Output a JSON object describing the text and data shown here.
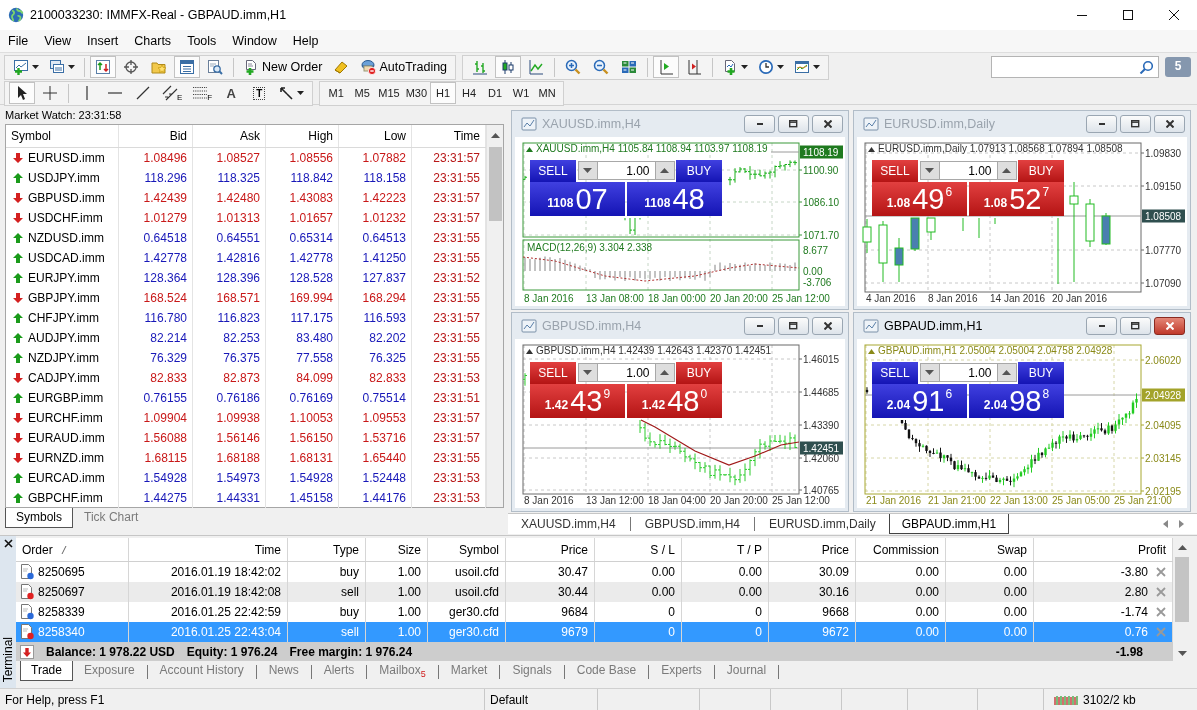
{
  "window": {
    "title": "2100033230: IMMFX-Real - GBPAUD.imm,H1"
  },
  "menu": [
    "File",
    "View",
    "Insert",
    "Charts",
    "Tools",
    "Window",
    "Help"
  ],
  "toolbar_top": [
    {
      "sections": [
        [
          {
            "kind": "new-chart",
            "pressed": false,
            "dropdown": true
          },
          {
            "kind": "profiles",
            "pressed": false,
            "dropdown": true
          }
        ],
        [
          {
            "kind": "market-watch",
            "pressed": true
          },
          {
            "kind": "data-window",
            "pressed": false
          },
          {
            "kind": "navigator",
            "pressed": false
          },
          {
            "kind": "terminal",
            "pressed": true
          },
          {
            "kind": "tester",
            "pressed": false
          }
        ],
        [
          {
            "kind": "new-order",
            "pressed": false,
            "label": "New Order"
          },
          {
            "kind": "editor",
            "pressed": false
          },
          {
            "kind": "autotrading",
            "pressed": false,
            "label": "AutoTrading"
          }
        ]
      ]
    },
    {
      "sections": [
        [
          {
            "kind": "bar-chart",
            "pressed": false
          },
          {
            "kind": "candles",
            "pressed": true
          },
          {
            "kind": "line-chart",
            "pressed": false
          }
        ],
        [
          {
            "kind": "zoom-in",
            "pressed": false
          },
          {
            "kind": "zoom-out",
            "pressed": false
          },
          {
            "kind": "tile",
            "pressed": false
          }
        ],
        [
          {
            "kind": "autoscroll",
            "pressed": true
          },
          {
            "kind": "chart-shift",
            "pressed": false
          }
        ],
        [
          {
            "kind": "indicators",
            "pressed": false,
            "dropdown": true
          },
          {
            "kind": "periods",
            "pressed": false,
            "dropdown": true
          },
          {
            "kind": "templates",
            "pressed": false,
            "dropdown": true
          }
        ]
      ]
    }
  ],
  "messages": {
    "count": "5"
  },
  "toolbar_bottom": [
    {
      "sections": [
        [
          {
            "kind": "cursor",
            "pressed": true
          },
          {
            "kind": "crosshair",
            "pressed": false
          }
        ],
        [
          {
            "kind": "vertical-line",
            "pressed": false
          },
          {
            "kind": "horizontal-line",
            "pressed": false
          },
          {
            "kind": "trend-line",
            "pressed": false
          },
          {
            "kind": "channel",
            "pressed": false,
            "mark": "E"
          },
          {
            "kind": "fibonacci",
            "pressed": false,
            "mark": "F"
          },
          {
            "kind": "text",
            "pressed": false,
            "label": "A"
          },
          {
            "kind": "text-label",
            "pressed": false,
            "label": "T"
          },
          {
            "kind": "arrows",
            "pressed": false,
            "dropdown": true
          }
        ]
      ]
    },
    {
      "sections": [
        [
          {
            "kind": "period",
            "label": "M1",
            "pressed": false
          },
          {
            "kind": "period",
            "label": "M5",
            "pressed": false
          },
          {
            "kind": "period",
            "label": "M15",
            "pressed": false
          },
          {
            "kind": "period",
            "label": "M30",
            "pressed": false
          },
          {
            "kind": "period",
            "label": "H1",
            "pressed": true
          },
          {
            "kind": "period",
            "label": "H4",
            "pressed": false
          },
          {
            "kind": "period",
            "label": "D1",
            "pressed": false
          },
          {
            "kind": "period",
            "label": "W1",
            "pressed": false
          },
          {
            "kind": "period",
            "label": "MN",
            "pressed": false
          }
        ]
      ]
    }
  ],
  "market_watch": {
    "title": "Market Watch: 23:31:58",
    "columns": [
      "Symbol",
      "Bid",
      "Ask",
      "High",
      "Low",
      "Time"
    ],
    "rows": [
      {
        "kind": "down",
        "symbol": "EURUSD.imm",
        "bid": "1.08496",
        "ask": "1.08527",
        "high": "1.08556",
        "low": "1.07882",
        "time": "23:31:57"
      },
      {
        "kind": "up",
        "symbol": "USDJPY.imm",
        "bid": "118.296",
        "ask": "118.325",
        "high": "118.842",
        "low": "118.158",
        "time": "23:31:55"
      },
      {
        "kind": "down",
        "symbol": "GBPUSD.imm",
        "bid": "1.42439",
        "ask": "1.42480",
        "high": "1.43083",
        "low": "1.42223",
        "time": "23:31:57"
      },
      {
        "kind": "down",
        "symbol": "USDCHF.imm",
        "bid": "1.01279",
        "ask": "1.01313",
        "high": "1.01657",
        "low": "1.01232",
        "time": "23:31:57"
      },
      {
        "kind": "up",
        "symbol": "NZDUSD.imm",
        "bid": "0.64518",
        "ask": "0.64551",
        "high": "0.65314",
        "low": "0.64513",
        "time": "23:31:55"
      },
      {
        "kind": "up",
        "symbol": "USDCAD.imm",
        "bid": "1.42778",
        "ask": "1.42816",
        "high": "1.42778",
        "low": "1.41250",
        "time": "23:31:55"
      },
      {
        "kind": "up",
        "symbol": "EURJPY.imm",
        "bid": "128.364",
        "ask": "128.396",
        "high": "128.528",
        "low": "127.837",
        "time": "23:31:52"
      },
      {
        "kind": "down",
        "symbol": "GBPJPY.imm",
        "bid": "168.524",
        "ask": "168.571",
        "high": "169.994",
        "low": "168.294",
        "time": "23:31:55"
      },
      {
        "kind": "up",
        "symbol": "CHFJPY.imm",
        "bid": "116.780",
        "ask": "116.823",
        "high": "117.175",
        "low": "116.593",
        "time": "23:31:57"
      },
      {
        "kind": "up",
        "symbol": "AUDJPY.imm",
        "bid": "82.214",
        "ask": "82.253",
        "high": "83.480",
        "low": "82.202",
        "time": "23:31:55"
      },
      {
        "kind": "up",
        "symbol": "NZDJPY.imm",
        "bid": "76.329",
        "ask": "76.375",
        "high": "77.558",
        "low": "76.325",
        "time": "23:31:55"
      },
      {
        "kind": "down",
        "symbol": "CADJPY.imm",
        "bid": "82.833",
        "ask": "82.873",
        "high": "84.099",
        "low": "82.833",
        "time": "23:31:53"
      },
      {
        "kind": "up",
        "symbol": "EURGBP.imm",
        "bid": "0.76155",
        "ask": "0.76186",
        "high": "0.76169",
        "low": "0.75514",
        "time": "23:31:51"
      },
      {
        "kind": "down",
        "symbol": "EURCHF.imm",
        "bid": "1.09904",
        "ask": "1.09938",
        "high": "1.10053",
        "low": "1.09553",
        "time": "23:31:57"
      },
      {
        "kind": "down",
        "symbol": "EURAUD.imm",
        "bid": "1.56088",
        "ask": "1.56146",
        "high": "1.56150",
        "low": "1.53716",
        "time": "23:31:57"
      },
      {
        "kind": "down",
        "symbol": "EURNZD.imm",
        "bid": "1.68115",
        "ask": "1.68188",
        "high": "1.68131",
        "low": "1.65440",
        "time": "23:31:55"
      },
      {
        "kind": "up",
        "symbol": "EURCAD.imm",
        "bid": "1.54928",
        "ask": "1.54973",
        "high": "1.54928",
        "low": "1.52448",
        "time": "23:31:53"
      },
      {
        "kind": "up",
        "symbol": "GBPCHF.imm",
        "bid": "1.44275",
        "ask": "1.44331",
        "high": "1.45158",
        "low": "1.44176",
        "time": "23:31:53"
      }
    ],
    "tabs": [
      {
        "label": "Symbols",
        "selected": true
      },
      {
        "label": "Tick Chart",
        "selected": false
      }
    ]
  },
  "charts": [
    {
      "title": "XAUUSD.imm,H4",
      "active": false,
      "kind": "bars",
      "legend": "XAUUSD.imm,H4 1105.84 1108.94 1103.97 1108.19",
      "price_labels": [
        "1100.90",
        "1086.10",
        "1071.70"
      ],
      "current_price": "1108.19",
      "date_labels": [
        "8 Jan 2016",
        "13 Jan 08:00",
        "18 Jan 00:00",
        "20 Jan 20:00",
        "25 Jan 12:00"
      ],
      "indicator": {
        "legend": "MACD(12,26,9) 3.304 2.338",
        "labels": [
          "8.677",
          "0.00",
          "-3.706"
        ]
      },
      "trade_panel": {
        "kind": "up",
        "lot": "1.00",
        "sell": {
          "label": "SELL",
          "big_figure": "1108",
          "pips": "07"
        },
        "buy": {
          "label": "BUY",
          "big_figure": "1108",
          "pips": "48"
        }
      }
    },
    {
      "title": "EURUSD.imm,Daily",
      "active": false,
      "kind": "candles",
      "legend": "EURUSD.imm,Daily 1.07913 1.08568 1.07894 1.08508",
      "price_labels": [
        "1.09830",
        "1.09150",
        "1.07770",
        "1.07090"
      ],
      "current_price": "1.08508",
      "date_labels": [
        "4 Jan 2016",
        "8 Jan 2016",
        "14 Jan 2016",
        "20 Jan 2016"
      ],
      "trade_panel": {
        "kind": "down",
        "lot": "1.00",
        "sell": {
          "label": "SELL",
          "big_figure": "1.08",
          "pips": "49",
          "fraction": "6"
        },
        "buy": {
          "label": "BUY",
          "big_figure": "1.08",
          "pips": "52",
          "fraction": "7"
        }
      }
    },
    {
      "title": "GBPUSD.imm,H4",
      "active": false,
      "kind": "bars",
      "legend": "GBPUSD.imm,H4 1.42439 1.42643 1.42370 1.42451",
      "price_labels": [
        "1.46015",
        "1.44685",
        "1.43390",
        "1.42060",
        "1.40765"
      ],
      "current_price": "1.42451",
      "date_labels": [
        "8 Jan 2016",
        "13 Jan 12:00",
        "18 Jan 04:00",
        "20 Jan 20:00",
        "25 Jan 12:00"
      ],
      "trade_panel": {
        "kind": "down",
        "lot": "1.00",
        "sell": {
          "label": "SELL",
          "big_figure": "1.42",
          "pips": "43",
          "fraction": "9"
        },
        "buy": {
          "label": "BUY",
          "big_figure": "1.42",
          "pips": "48",
          "fraction": "0"
        }
      }
    },
    {
      "title": "GBPAUD.imm,H1",
      "active": true,
      "kind": "candles",
      "legend": "GBPAUD.imm,H1 2.05004 2.05004 2.04758 2.04928",
      "price_labels": [
        "2.06020",
        "2.04095",
        "2.03145",
        "2.02195"
      ],
      "current_price": "2.04928",
      "date_labels": [
        "21 Jan 2016",
        "21 Jan 21:00",
        "22 Jan 13:00",
        "25 Jan 05:00",
        "25 Jan 21:00"
      ],
      "trade_panel": {
        "kind": "up",
        "lot": "1.00",
        "sell": {
          "label": "SELL",
          "big_figure": "2.04",
          "pips": "91",
          "fraction": "6"
        },
        "buy": {
          "label": "BUY",
          "big_figure": "2.04",
          "pips": "98",
          "fraction": "8"
        }
      }
    }
  ],
  "chart_tabs": [
    {
      "label": "XAUUSD.imm,H4",
      "selected": false
    },
    {
      "label": "GBPUSD.imm,H4",
      "selected": false
    },
    {
      "label": "EURUSD.imm,Daily",
      "selected": false
    },
    {
      "label": "GBPAUD.imm,H1",
      "selected": true
    }
  ],
  "terminal": {
    "title": "Terminal",
    "columns": [
      {
        "label": "Order",
        "sorted": true
      },
      {
        "label": "Time",
        "sorted": false
      },
      {
        "label": "Type",
        "sorted": false
      },
      {
        "label": "Size",
        "sorted": false
      },
      {
        "label": "Symbol",
        "sorted": false
      },
      {
        "label": "Price",
        "sorted": false
      },
      {
        "label": "S / L",
        "sorted": false
      },
      {
        "label": "T / P",
        "sorted": false
      },
      {
        "label": "Price",
        "sorted": false
      },
      {
        "label": "Commission",
        "sorted": false
      },
      {
        "label": "Swap",
        "sorted": false
      },
      {
        "label": "Profit",
        "sorted": false
      }
    ],
    "rows": [
      {
        "kind": "buy",
        "selected": false,
        "cells": [
          "8250695",
          "2016.01.19 18:42:02",
          "buy",
          "1.00",
          "usoil.cfd",
          "30.47",
          "0.00",
          "0.00",
          "30.09",
          "0.00",
          "0.00",
          "-3.80"
        ]
      },
      {
        "kind": "sell",
        "selected": false,
        "cells": [
          "8250697",
          "2016.01.19 18:42:08",
          "sell",
          "1.00",
          "usoil.cfd",
          "30.44",
          "0.00",
          "0.00",
          "30.16",
          "0.00",
          "0.00",
          "2.80"
        ]
      },
      {
        "kind": "buy",
        "selected": false,
        "cells": [
          "8258339",
          "2016.01.25 22:42:59",
          "buy",
          "1.00",
          "ger30.cfd",
          "9684",
          "0",
          "0",
          "9668",
          "0.00",
          "0.00",
          "-1.74"
        ]
      },
      {
        "kind": "sell",
        "selected": true,
        "cells": [
          "8258340",
          "2016.01.25 22:43:04",
          "sell",
          "1.00",
          "ger30.cfd",
          "9679",
          "0",
          "0",
          "9672",
          "0.00",
          "0.00",
          "0.76"
        ]
      }
    ],
    "summary": {
      "items": [
        "Balance: 1 978.22 USD",
        "Equity: 1 976.24",
        "Free margin: 1 976.24"
      ],
      "profit": "-1.98"
    },
    "tabs": [
      {
        "label": "Trade",
        "selected": true
      },
      {
        "label": "Exposure",
        "selected": false
      },
      {
        "label": "Account History",
        "selected": false
      },
      {
        "label": "News",
        "selected": false
      },
      {
        "label": "Alerts",
        "selected": false
      },
      {
        "label": "Mailbox",
        "selected": false,
        "badge": "5"
      },
      {
        "label": "Market",
        "selected": false
      },
      {
        "label": "Signals",
        "selected": false
      },
      {
        "label": "Code Base",
        "selected": false
      },
      {
        "label": "Experts",
        "selected": false
      },
      {
        "label": "Journal",
        "selected": false
      }
    ]
  },
  "status_bar": {
    "help": "For Help, press F1",
    "profile": "Default",
    "traffic": "3102/2 kb"
  }
}
